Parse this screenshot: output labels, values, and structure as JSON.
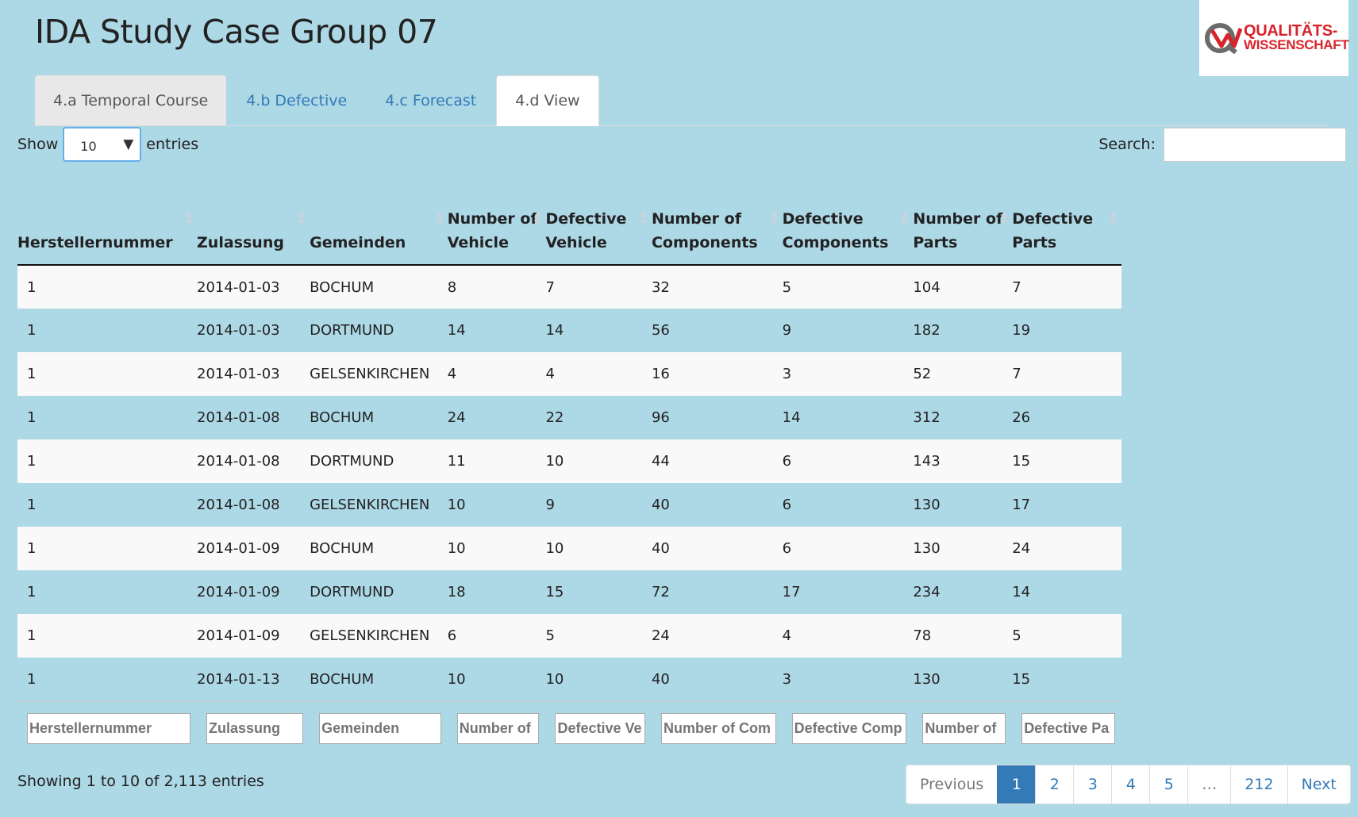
{
  "app": {
    "title": "IDA Study Case Group 07"
  },
  "logo": {
    "line1": "QUALITÄTS-",
    "line2": "WISSENSCHAFT"
  },
  "tabs": [
    {
      "label": "4.a Temporal Course"
    },
    {
      "label": "4.b Defective"
    },
    {
      "label": "4.c Forecast"
    },
    {
      "label": "4.d View"
    }
  ],
  "length": {
    "show": "Show",
    "value": "10",
    "entries": "entries"
  },
  "search": {
    "label": "Search:",
    "value": ""
  },
  "table": {
    "headers": [
      "Herstellernummer",
      "Zulassung",
      "Gemeinden",
      "Number of Vehicle",
      "Defective Vehicle",
      "Number of Components",
      "Defective Components",
      "Number of Parts",
      "Defective Parts"
    ],
    "rows": [
      [
        "1",
        "2014-01-03",
        "BOCHUM",
        "8",
        "7",
        "32",
        "5",
        "104",
        "7"
      ],
      [
        "1",
        "2014-01-03",
        "DORTMUND",
        "14",
        "14",
        "56",
        "9",
        "182",
        "19"
      ],
      [
        "1",
        "2014-01-03",
        "GELSENKIRCHEN",
        "4",
        "4",
        "16",
        "3",
        "52",
        "7"
      ],
      [
        "1",
        "2014-01-08",
        "BOCHUM",
        "24",
        "22",
        "96",
        "14",
        "312",
        "26"
      ],
      [
        "1",
        "2014-01-08",
        "DORTMUND",
        "11",
        "10",
        "44",
        "6",
        "143",
        "15"
      ],
      [
        "1",
        "2014-01-08",
        "GELSENKIRCHEN",
        "10",
        "9",
        "40",
        "6",
        "130",
        "17"
      ],
      [
        "1",
        "2014-01-09",
        "BOCHUM",
        "10",
        "10",
        "40",
        "6",
        "130",
        "24"
      ],
      [
        "1",
        "2014-01-09",
        "DORTMUND",
        "18",
        "15",
        "72",
        "17",
        "234",
        "14"
      ],
      [
        "1",
        "2014-01-09",
        "GELSENKIRCHEN",
        "6",
        "5",
        "24",
        "4",
        "78",
        "5"
      ],
      [
        "1",
        "2014-01-13",
        "BOCHUM",
        "10",
        "10",
        "40",
        "3",
        "130",
        "15"
      ]
    ],
    "filters": [
      "Herstellernummer",
      "Zulassung",
      "Gemeinden",
      "Number of",
      "Defective Ve",
      "Number of Com",
      "Defective Comp",
      "Number of",
      "Defective Pa"
    ]
  },
  "info": "Showing 1 to 10 of 2,113 entries",
  "pagination": {
    "previous": "Previous",
    "pages": [
      "1",
      "2",
      "3",
      "4",
      "5",
      "…",
      "212"
    ],
    "next": "Next"
  }
}
